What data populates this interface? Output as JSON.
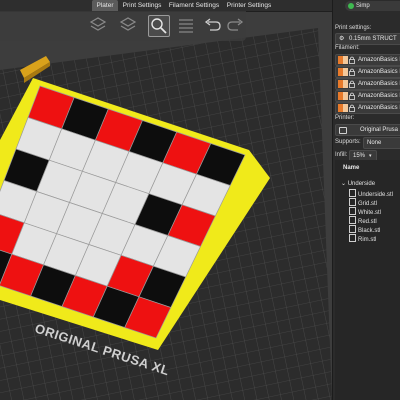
{
  "tabs": [
    {
      "label": "Plater",
      "active": true
    },
    {
      "label": "Print Settings",
      "active": false
    },
    {
      "label": "Filament Settings",
      "active": false
    },
    {
      "label": "Printer Settings",
      "active": false
    }
  ],
  "toolbar": {
    "icons": [
      "layers-icon",
      "layers-icon",
      "zoom-icon",
      "list-icon",
      "undo-icon",
      "redo-icon"
    ]
  },
  "bed": {
    "label": "ORIGINAL PRUSA XL",
    "colors": {
      "plate": "#2c2c2c",
      "frame": "#f0ea1a",
      "red": "#ee1111",
      "black": "#0d0d0d",
      "white": "#e4e4e4",
      "grid": "#555555"
    }
  },
  "checkerboard": [
    [
      "red",
      "black",
      "red",
      "black",
      "red",
      "black"
    ],
    [
      "white",
      "white",
      "white",
      "white",
      "white",
      "white"
    ],
    [
      "black",
      "white",
      "white",
      "white",
      "black",
      "red"
    ],
    [
      "white",
      "white",
      "white",
      "white",
      "white",
      "white"
    ],
    [
      "red",
      "white",
      "white",
      "white",
      "red",
      "black"
    ],
    [
      "black",
      "red",
      "black",
      "red",
      "black",
      "red"
    ]
  ],
  "panel": {
    "mode_label": "Simp",
    "print_settings_label": "Print settings:",
    "print_settings_value": "0.15mm STRUCT",
    "filament_label": "Filament:",
    "filaments": [
      {
        "name": "AmazonBasics P",
        "color": "#e87a2a"
      },
      {
        "name": "AmazonBasics P",
        "color": "#e87a2a"
      },
      {
        "name": "AmazonBasics P",
        "color": "#e87a2a"
      },
      {
        "name": "AmazonBasics P",
        "color": "#e87a2a"
      },
      {
        "name": "AmazonBasics P",
        "color": "#e87a2a"
      }
    ],
    "printer_label": "Printer:",
    "printer_value": "Original Prusa X",
    "supports_label": "Supports:",
    "supports_value": "None",
    "infill_label": "Infill:",
    "infill_value": "15%",
    "tree_header": "Name",
    "tree_root": "Underside",
    "tree_items": [
      "Underside.stl",
      "Grid.stl",
      "White.stl",
      "Red.stl",
      "Black.stl",
      "Rim.stl"
    ]
  }
}
